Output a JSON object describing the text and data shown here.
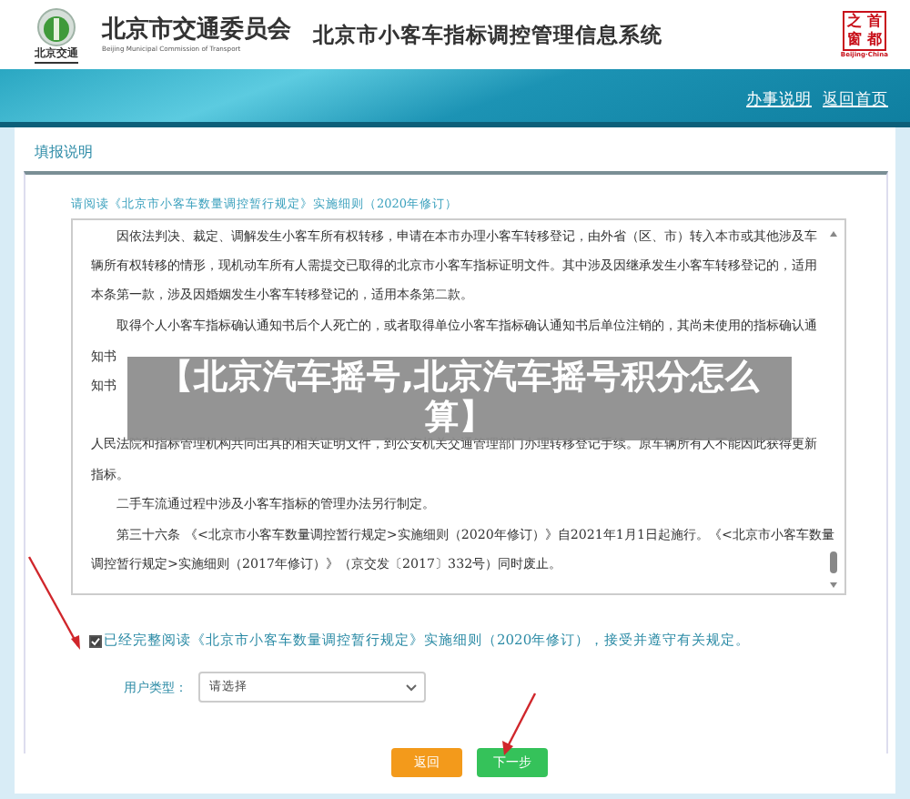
{
  "header": {
    "logo_caption": "北京交通",
    "org_name": "北京市交通委员会",
    "org_name_en": "Beijing Municipal Commission of Transport",
    "system_title": "北京市小客车指标调控管理信息系统",
    "seal_chars": [
      "之",
      "首",
      "窗",
      "都"
    ],
    "seal_caption": "Beijing·China"
  },
  "nav_links": [
    "办事说明",
    "返回首页"
  ],
  "section_title": "填报说明",
  "notice": {
    "title": "请阅读《北京市小客车数量调控暂行规定》实施细则（2020年修订）",
    "paragraphs": [
      {
        "kind": "paragraph",
        "lines": [
          "因依法判决、裁定、调解发生小客车所有权转移，申请在本市办理小客车转移登记，由外省（区、市）转入本市或其他涉及车",
          "辆所有权转移的情形，现机动车所有人需提交已取得的北京市小客车指标证明文件。其中涉及因继承发生小客车转移登记的，适用",
          "本条第一款，涉及因婚姻发生小客车转移登记的，适用本条第二款。"
        ]
      },
      {
        "kind": "paragraph",
        "lines": [
          "取得个人小客车指标确认通知书后个人死亡的，或者取得单位小客车指标确认通知书后单位注销的，其尚未使用的指标确认通"
        ]
      },
      {
        "kind": "fragment",
        "lines": [
          "知书"
        ]
      },
      {
        "kind": "fragment",
        "lines": [
          "知书"
        ]
      },
      {
        "kind": "continuation",
        "lines": [
          "人民法院和指标管理机构共同出具的相关证明文件，到公安机关交通管理部门办理转移登记手续。原车辆所有人不能因此获得更新",
          "指标。"
        ]
      },
      {
        "kind": "paragraph",
        "lines": [
          "二手车流通过程中涉及小客车指标的管理办法另行制定。"
        ]
      },
      {
        "kind": "paragraph",
        "lines": [
          "第三十六条 《<北京市小客车数量调控暂行规定>实施细则（2020年修订）》自2021年1月1日起施行。《<北京市小客车数量",
          "调控暂行规定>实施细则（2017年修订）》（京交发〔2017〕332号）同时废止。"
        ]
      }
    ]
  },
  "agreement": {
    "checked": true,
    "text": "已经完整阅读《北京市小客车数量调控暂行规定》实施细则（2020年修订），接受并遵守有关规定。"
  },
  "user_type": {
    "label": "用户类型：",
    "value": "请选择"
  },
  "buttons": [
    {
      "label": "返回",
      "kind": "back"
    },
    {
      "label": "下一步",
      "kind": "next"
    }
  ],
  "overlay_title": "【北京汽车摇号,北京汽车摇号积分怎么算】"
}
